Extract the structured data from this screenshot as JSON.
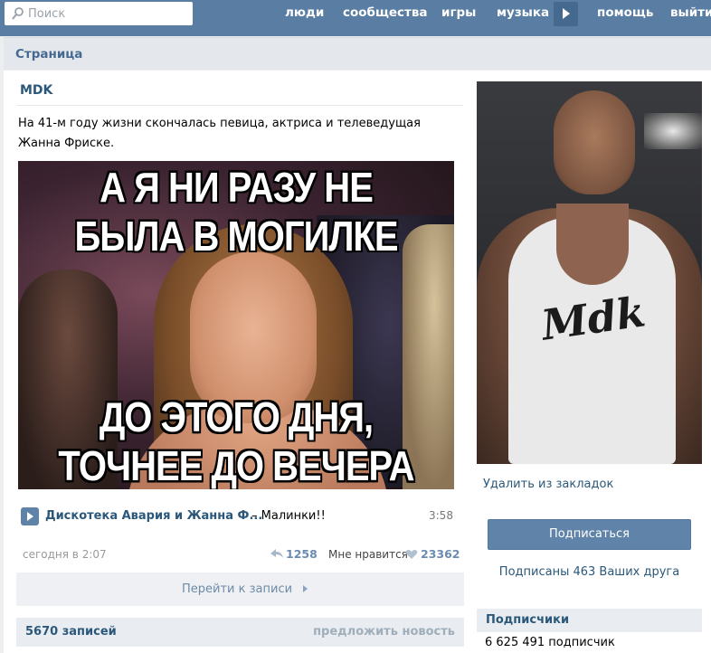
{
  "topbar": {
    "search_placeholder": "Поиск",
    "nav": [
      "люди",
      "сообщества",
      "игры",
      "музыка",
      "помощь",
      "выйти"
    ]
  },
  "page_header": "Страница",
  "post": {
    "author": "MDK",
    "text": "На 41-м году жизни скончалась певица, актриса и телеведущая Жанна Фриске.",
    "image_text_top_1": "А Я НИ РАЗУ НЕ",
    "image_text_top_2": "БЫЛА В МОГИЛКЕ",
    "image_text_bottom_1": "ДО ЭТОГО ДНЯ,",
    "image_text_bottom_2": "ТОЧНЕЕ ДО ВЕЧЕРА",
    "audio": {
      "artist": "Дискотека Авария и Жанна Ф...",
      "title": "– Малинки!!",
      "duration": "3:58"
    },
    "date": "сегодня в 2:07",
    "shares": "1258",
    "like_label": "Мне нравится",
    "likes": "23362",
    "goto_label": "Перейти к записи"
  },
  "wall": {
    "count": "5670 записей",
    "suggest": "предложить новость"
  },
  "sidebar": {
    "avatar_logo": "Mdk",
    "unbookmark": "Удалить из закладок",
    "subscribe": "Подписаться",
    "friends_subscribed": "Подписаны 463 Ваших друга",
    "subscribers_header": "Подписчики",
    "subscribers_count": "6 625 491 подписчик"
  },
  "colors": {
    "topbar": "#597da3",
    "link": "#2b587a",
    "button": "#6083a9"
  }
}
